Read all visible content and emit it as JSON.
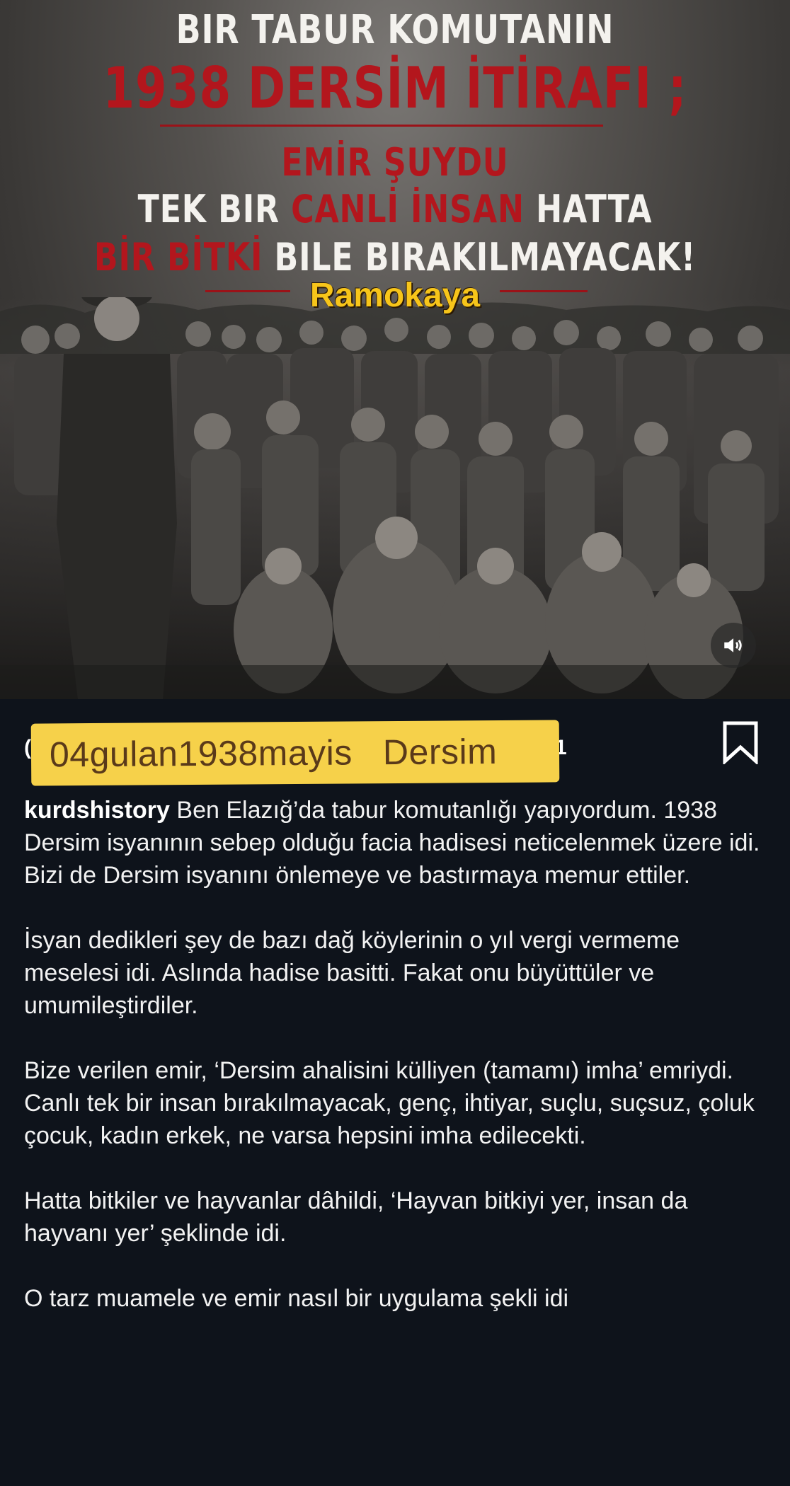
{
  "poster": {
    "line1": "BIR TABUR KOMUTANIN",
    "line2": "1938 DERSİM İTİRAFI ;",
    "line3": "EMİR ŞUYDU",
    "line4_a": "TEK BIR ",
    "line4_b": "CANLİ İNSAN",
    "line4_c": " HATTA",
    "line5_a": "BİR BİTKİ",
    "line5_b": " BILE BIRAKILMAYACAK!",
    "brand": "Ramokaya"
  },
  "media": {
    "sound_icon": "speaker-icon"
  },
  "header": {
    "hashtags": "04gulan1938mayis   Dersim",
    "obscured_left": "(",
    "obscured_right": "1",
    "bookmark_icon": "bookmark-icon"
  },
  "caption": {
    "username": "kurdshistory",
    "p1": " Ben Elazığ’da tabur komutanlığı yapıyordum. 1938 Dersim isyanının sebep olduğu facia hadisesi neticelenmek üzere idi. Bizi de Dersim isyanını önlemeye ve bastırmaya memur ettiler.",
    "p2": "İsyan dedikleri şey de bazı dağ köylerinin o yıl vergi vermeme meselesi idi. Aslında hadise basitti. Fakat onu büyüttüler ve umumileştirdiler.",
    "p3": "Bize verilen emir, ‘Dersim ahalisini külliyen (tamamı) imha’ emriydi. Canlı tek bir insan bırakılmayacak, genç, ihtiyar, suçlu, suçsuz, çoluk çocuk, kadın erkek, ne varsa hepsini imha edilecekti.",
    "p4": "Hatta bitkiler ve hayvanlar dâhildi, ‘Hayvan bitkiyi yer, insan da hayvanı yer’ şeklinde idi.",
    "p5": "O tarz muamele ve emir nasıl bir uygulama şekli idi"
  }
}
